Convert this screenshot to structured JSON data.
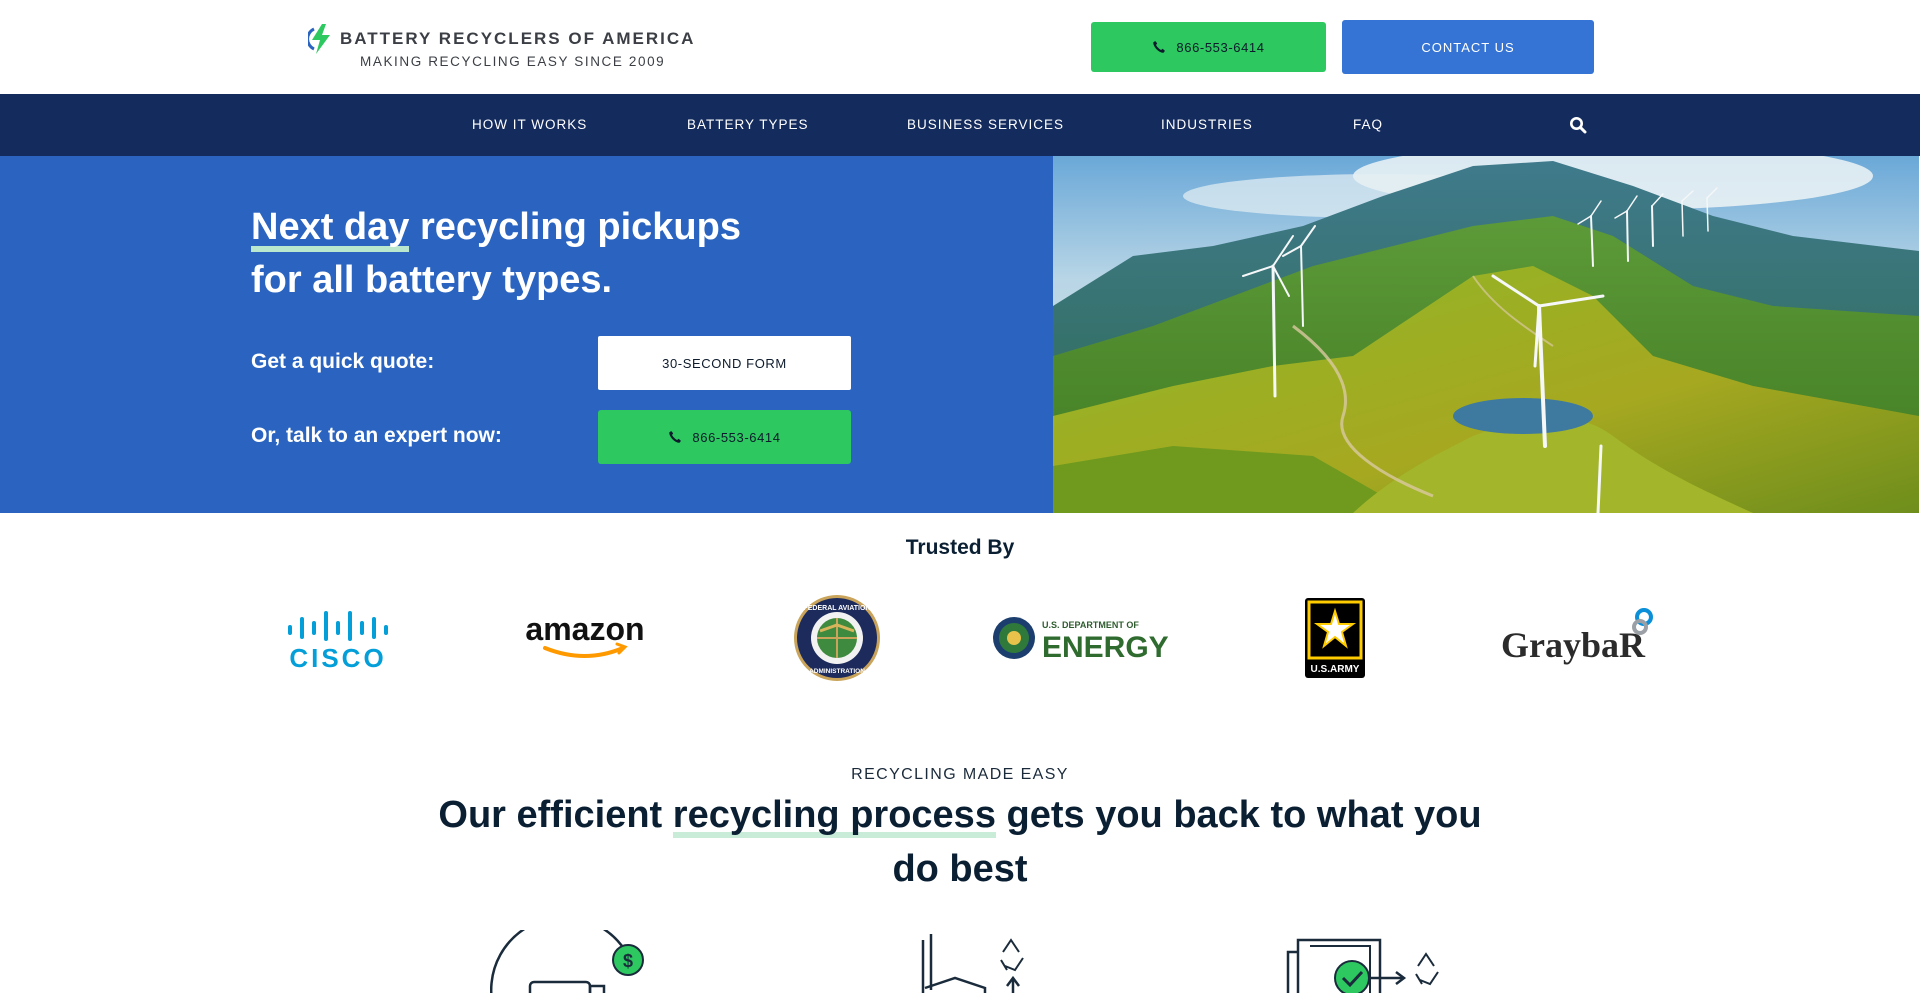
{
  "header": {
    "logo_name": "BATTERY RECYCLERS OF AMERICA",
    "logo_tagline": "MAKING RECYCLING EASY SINCE 2009",
    "phone_label": "866-553-6414",
    "contact_label": "CONTACT US"
  },
  "nav": {
    "items": [
      "HOW IT WORKS",
      "BATTERY TYPES",
      "BUSINESS SERVICES",
      "INDUSTRIES",
      "FAQ"
    ],
    "search_icon": "search-icon"
  },
  "hero": {
    "title_highlight": "Next day",
    "title_rest": " recycling pickups",
    "title_line2": "for all battery types.",
    "quote_label": "Get a quick quote:",
    "quote_button": "30-SECOND FORM",
    "expert_label": "Or, talk to an expert now:",
    "expert_button": "866-553-6414"
  },
  "trusted": {
    "title": "Trusted By",
    "logos": [
      {
        "name": "cisco",
        "text": "CISCO"
      },
      {
        "name": "amazon",
        "text": "amazon"
      },
      {
        "name": "faa",
        "text_top": "FEDERAL AVIATION",
        "text_bottom": "ADMINISTRATION"
      },
      {
        "name": "doe",
        "text_small": "U.S. DEPARTMENT OF",
        "text_big": "ENERGY"
      },
      {
        "name": "army",
        "text": "U.S.ARMY"
      },
      {
        "name": "graybar",
        "text": "GraybaR"
      }
    ]
  },
  "process": {
    "eyebrow": "RECYCLING MADE EASY",
    "title_pre": "Our efficient ",
    "title_highlight": "recycling process",
    "title_post": " gets you back to what you do best"
  },
  "colors": {
    "nav_bg": "#142b5e",
    "hero_bg": "#2a64c0",
    "green": "#2dc85f",
    "blue_button": "#3574d4",
    "text_dark": "#0b1f33"
  }
}
